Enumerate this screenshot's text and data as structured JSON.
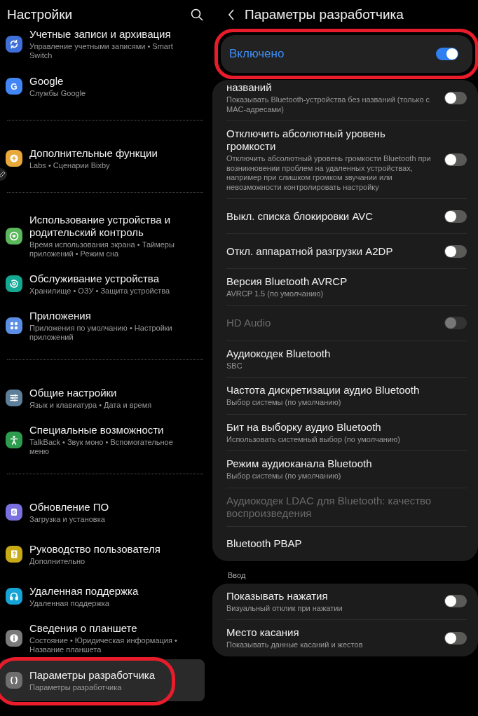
{
  "settings": {
    "title": "Настройки",
    "groups": [
      {
        "items": [
          {
            "title": "Учетные записи и архивация",
            "subtitle": "Управление учетными записями • Smart Switch",
            "kind": "sync",
            "color": "#3f6fd8",
            "selected": false,
            "highlighted": false
          },
          {
            "title": "Google",
            "subtitle": "Службы Google",
            "kind": "letter",
            "glyph": "G",
            "color": "#4285f4",
            "selected": false,
            "highlighted": false
          }
        ]
      },
      {
        "items": [
          {
            "title": "Дополнительные функции",
            "subtitle": "Labs • Сценарии Bixby",
            "kind": "gear-plus",
            "color": "#e8a93a",
            "selected": false,
            "highlighted": false
          }
        ]
      },
      {
        "items": [
          {
            "title": "Использование устройства и родительский контроль",
            "subtitle": "Время использования экрана • Таймеры приложений • Режим сна",
            "kind": "heart",
            "color": "#5bb75b",
            "selected": false,
            "highlighted": false
          },
          {
            "title": "Обслуживание устройства",
            "subtitle": "Хранилище • ОЗУ • Защита устройства",
            "kind": "refresh",
            "color": "#13a892",
            "selected": false,
            "highlighted": false
          },
          {
            "title": "Приложения",
            "subtitle": "Приложения по умолчанию • Настройки приложений",
            "kind": "dots",
            "color": "#5b8fe6",
            "selected": false,
            "highlighted": false
          }
        ]
      },
      {
        "items": [
          {
            "title": "Общие настройки",
            "subtitle": "Язык и клавиатура • Дата и время",
            "kind": "sliders",
            "color": "#5e7f9a",
            "selected": false,
            "highlighted": false
          },
          {
            "title": "Специальные возможности",
            "subtitle": "TalkBack • Звук моно • Вспомогательное меню",
            "kind": "person",
            "color": "#2e9c4f",
            "selected": false,
            "highlighted": false
          }
        ]
      },
      {
        "items": [
          {
            "title": "Обновление ПО",
            "subtitle": "Загрузка и установка",
            "kind": "update",
            "color": "#7a70e0",
            "selected": false,
            "highlighted": false
          },
          {
            "title": "Руководство пользователя",
            "subtitle": "Дополнительно",
            "kind": "manual",
            "color": "#c8aa16",
            "selected": false,
            "highlighted": false
          },
          {
            "title": "Удаленная поддержка",
            "subtitle": "Удаленная поддержка",
            "kind": "headset",
            "color": "#16a3d6",
            "selected": false,
            "highlighted": false
          },
          {
            "title": "Сведения о планшете",
            "subtitle": "Состояние • Юридическая информация • Название планшета",
            "kind": "info",
            "color": "#7a7a7a",
            "selected": false,
            "highlighted": false
          },
          {
            "title": "Параметры разработчика",
            "subtitle": "Параметры разработчика",
            "kind": "braces",
            "color": "#6e6e6e",
            "selected": true,
            "highlighted": true
          }
        ]
      }
    ]
  },
  "developer": {
    "title": "Параметры разработчика",
    "master": {
      "label": "Включено",
      "on": true,
      "highlighted": true
    },
    "cards": [
      {
        "rows": [
          {
            "kind": "switch",
            "title": "названий",
            "subtitle": "Показывать Bluetooth-устройства без названий (только с MAC-адресами)",
            "on": false,
            "disabled": false
          },
          {
            "kind": "switch",
            "title": "Отключить абсолютный уровень громкости",
            "subtitle": "Отключить абсолютный уровень громкости Bluetooth при возникновении проблем на удаленных устройствах, например при слишком громком звучании или невозможности контролировать настройку",
            "on": false,
            "disabled": false
          },
          {
            "kind": "switch",
            "title": "Выкл. списка блокировки AVC",
            "on": false,
            "disabled": false
          },
          {
            "kind": "switch",
            "title": "Откл. аппаратной разгрузки A2DP",
            "on": false,
            "disabled": false
          },
          {
            "kind": "value",
            "title": "Версия Bluetooth AVRCP",
            "subtitle": "AVRCP 1.5 (по умолчанию)",
            "disabled": false
          },
          {
            "kind": "switch",
            "title": "HD Audio",
            "on": false,
            "disabled": true
          },
          {
            "kind": "value",
            "title": "Аудиокодек Bluetooth",
            "subtitle": "SBC",
            "disabled": false
          },
          {
            "kind": "value",
            "title": "Частота дискретизации аудио Bluetooth",
            "subtitle": "Выбор системы (по умолчанию)",
            "disabled": false
          },
          {
            "kind": "value",
            "title": "Бит на выборку аудио Bluetooth",
            "subtitle": "Использовать системный выбор (по умолчанию)",
            "disabled": false
          },
          {
            "kind": "value",
            "title": "Режим аудиоканала Bluetooth",
            "subtitle": "Выбор системы (по умолчанию)",
            "disabled": false
          },
          {
            "kind": "value",
            "title": "Аудиокодек LDAC для Bluetooth: качество воспроизведения",
            "disabled": true
          },
          {
            "kind": "value",
            "title": "Bluetooth PBAP",
            "disabled": false
          }
        ]
      },
      {
        "label": "Ввод",
        "rows": [
          {
            "kind": "switch",
            "title": "Показывать нажатия",
            "subtitle": "Визуальный отклик при нажатии",
            "on": false,
            "disabled": false
          },
          {
            "kind": "switch",
            "title": "Место касания",
            "subtitle": "Показывать данные касаний и жестов",
            "on": false,
            "disabled": false
          }
        ]
      }
    ]
  }
}
